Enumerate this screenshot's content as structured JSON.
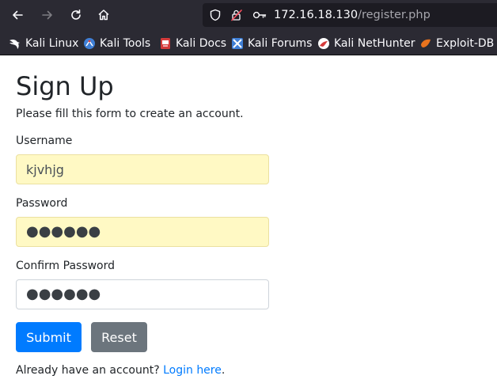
{
  "browser": {
    "url_host": "172.16.18.130",
    "url_path": "/register.php"
  },
  "bookmarks": [
    {
      "label": "Kali Linux",
      "icon": "kali-dragon-icon"
    },
    {
      "label": "Kali Tools",
      "icon": "kali-tools-icon"
    },
    {
      "label": "Kali Docs",
      "icon": "kali-docs-icon"
    },
    {
      "label": "Kali Forums",
      "icon": "kali-forums-icon"
    },
    {
      "label": "Kali NetHunter",
      "icon": "kali-nethunter-icon"
    },
    {
      "label": "Exploit-DB",
      "icon": "exploit-db-icon"
    }
  ],
  "form": {
    "title": "Sign Up",
    "subtitle": "Please fill this form to create an account.",
    "username_label": "Username",
    "username_value": "kjvhjg",
    "password_label": "Password",
    "password_value": "●●●●●●",
    "confirm_label": "Confirm Password",
    "confirm_value": "●●●●●●",
    "submit_label": "Submit",
    "reset_label": "Reset",
    "footer_text": "Already have an account? ",
    "login_link": "Login here",
    "footer_end": "."
  },
  "colors": {
    "chrome_bg": "#2b2a33",
    "primary": "#007bff",
    "secondary": "#6c757d",
    "autofill": "#fff9c4"
  }
}
